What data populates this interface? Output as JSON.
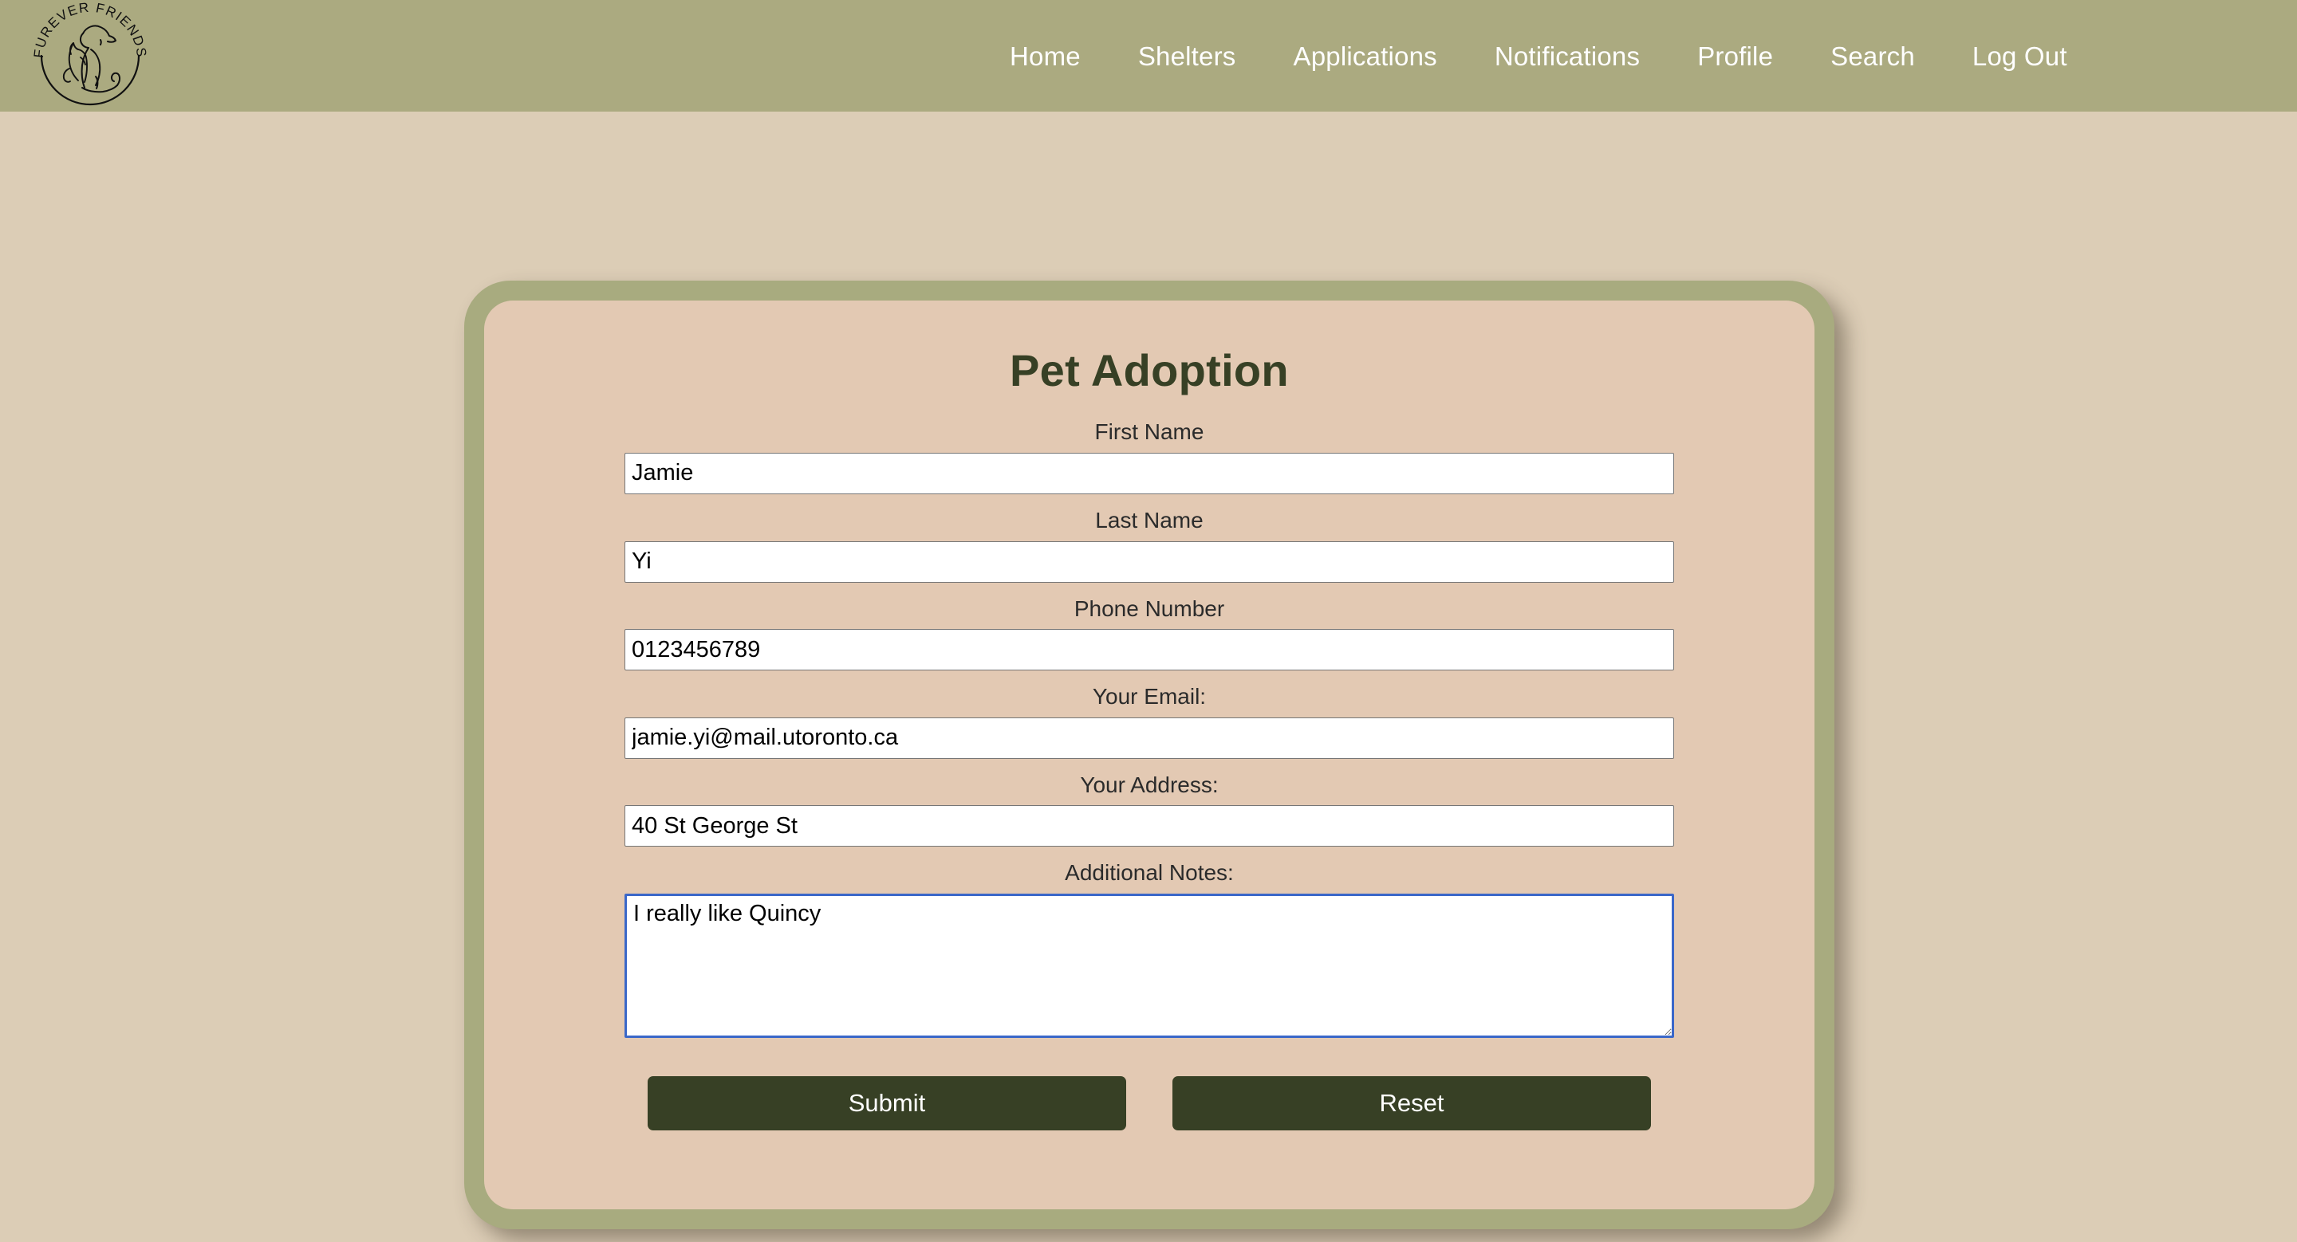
{
  "brand": {
    "logo_icon": "furever-friends-circular-logo",
    "logo_text_top": "FUREVER FRIENDS"
  },
  "nav": {
    "items": [
      {
        "label": "Home"
      },
      {
        "label": "Shelters"
      },
      {
        "label": "Applications"
      },
      {
        "label": "Notifications"
      },
      {
        "label": "Profile"
      },
      {
        "label": "Search"
      },
      {
        "label": "Log Out"
      }
    ]
  },
  "card": {
    "title": "Pet Adoption"
  },
  "form": {
    "fields": [
      {
        "label": "First Name",
        "value": "Jamie",
        "placeholder": ""
      },
      {
        "label": "Last Name",
        "value": "Yi",
        "placeholder": ""
      },
      {
        "label": "Phone Number",
        "value": "0123456789",
        "placeholder": ""
      },
      {
        "label": "Your Email:",
        "value": "jamie.yi@mail.utoronto.ca",
        "placeholder": ""
      },
      {
        "label": "Your Address:",
        "value": "40 St George St",
        "placeholder": ""
      }
    ],
    "notes": {
      "label": "Additional Notes:",
      "value": "I really like Quincy",
      "placeholder": "",
      "focused": true
    },
    "submit_label": "Submit",
    "reset_label": "Reset"
  },
  "colors": {
    "nav_background": "#abaa80",
    "page_background": "#dccdb6",
    "card_border": "#a8ab7f",
    "card_background": "#e3c9b3",
    "accent_dark_green": "#374025",
    "focus_border": "#3a67c9"
  }
}
